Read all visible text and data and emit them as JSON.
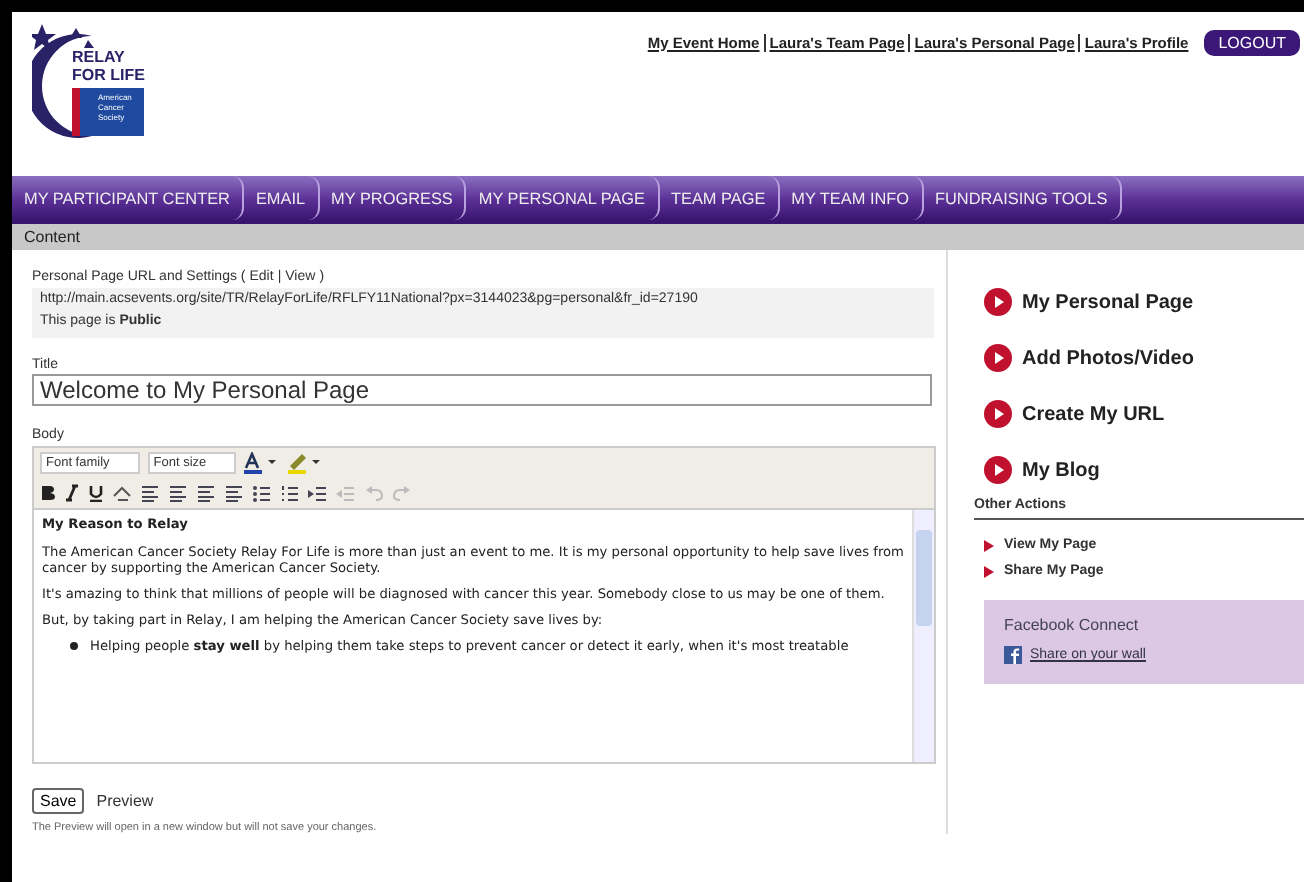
{
  "header": {
    "logo": {
      "line1": "RELAY",
      "line2": "FOR LIFE",
      "badge": "American Cancer Society"
    },
    "links": [
      {
        "label": "My Event Home"
      },
      {
        "label": "Laura's Team Page"
      },
      {
        "label": "Laura's Personal Page"
      },
      {
        "label": "Laura's Profile"
      }
    ],
    "logout": "LOGOUT"
  },
  "nav": [
    {
      "label": "MY PARTICIPANT CENTER",
      "selected": false
    },
    {
      "label": "EMAIL",
      "selected": false
    },
    {
      "label": "MY PROGRESS",
      "selected": false
    },
    {
      "label": "MY PERSONAL PAGE",
      "selected": false
    },
    {
      "label": "TEAM PAGE",
      "selected": false
    },
    {
      "label": "MY TEAM INFO",
      "selected": false
    },
    {
      "label": "FUNDRAISING TOOLS",
      "selected": false
    }
  ],
  "section_title": "Content",
  "settings": {
    "heading": "Personal Page URL and Settings (",
    "edit": "Edit",
    "separator": "|",
    "view": "View",
    "close": ")",
    "url": "http://main.acsevents.org/site/TR/RelayForLife/RFLFY11National?px=3144023&pg=personal&fr_id=27190",
    "visibility": "This page is **Public**"
  },
  "title_field": {
    "label": "Title",
    "value": "Welcome to My Personal Page"
  },
  "body_field": {
    "label": "Body",
    "font_family": "Font family",
    "font_size": "Font size",
    "content": [
      {
        "kind": "heading",
        "text": "My Reason to Relay"
      },
      {
        "kind": "paragraph",
        "text": "The American Cancer Society Relay For Life is more than just an event to me. It is my personal opportunity to help save lives from cancer by supporting the American Cancer Society."
      },
      {
        "kind": "paragraph",
        "text": "It's amazing to think that millions of people will be diagnosed with cancer this year. Somebody close to us may be one of them."
      },
      {
        "kind": "paragraph",
        "text": "But, by taking part in Relay, I am helping the American Cancer Society save lives by:"
      },
      {
        "kind": "bullet",
        "text": "Helping people **stay well** by helping them take steps to prevent cancer or detect it early, when it's most treatable"
      }
    ]
  },
  "save": "Save",
  "preview": "Preview",
  "preview_note": "The Preview will open in a new window but will not save your changes.",
  "sidebar": {
    "actions": [
      {
        "label": "My Personal Page"
      },
      {
        "label": "Add Photos/Video"
      },
      {
        "label": "Create My URL"
      },
      {
        "label": "My Blog"
      }
    ],
    "other_title": "Other Actions",
    "other": [
      {
        "label": "View My Page"
      },
      {
        "label": "Share My Page"
      }
    ],
    "facebook": {
      "title": "Facebook Connect",
      "link": "Share on your wall"
    }
  }
}
